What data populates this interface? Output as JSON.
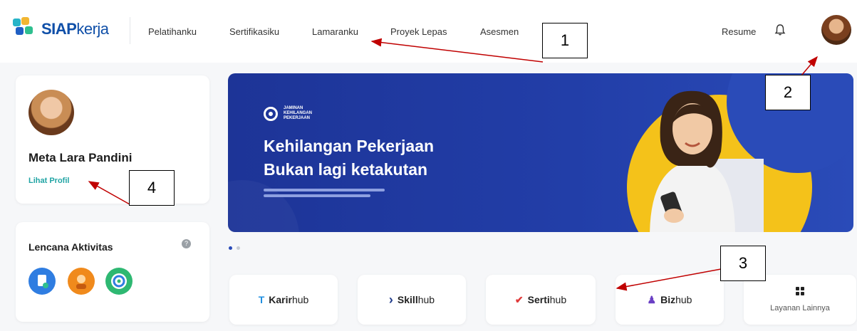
{
  "header": {
    "logo_bold": "SIAP",
    "logo_light": "kerja",
    "nav": [
      "Pelatihanku",
      "Sertifikasiku",
      "Lamaranku",
      "Proyek Lepas",
      "Asesmen"
    ],
    "resume": "Resume",
    "icons": {
      "notification": "bell-icon",
      "avatar": "user-avatar"
    }
  },
  "profile": {
    "name": "Meta Lara Pandini",
    "link": "Lihat Profil"
  },
  "badges": {
    "title": "Lencana Aktivitas",
    "help": "?",
    "colors": [
      "#2f7de1",
      "#f08a1c",
      "#2eb872"
    ]
  },
  "banner": {
    "logo_text": "JAMINAN KEHILANGAN PEKERJAAN",
    "title_line1": "Kehilangan Pekerjaan",
    "title_line2": "Bukan lagi ketakutan"
  },
  "services": [
    {
      "bold": "Karir",
      "light": "hub",
      "icon": "T",
      "color": "#1f8fe0"
    },
    {
      "bold": "Skill",
      "light": "hub",
      "icon": "›",
      "color": "#1f3a8a"
    },
    {
      "bold": "Serti",
      "light": "hub",
      "icon": "✔",
      "color": "#e03a3a"
    },
    {
      "bold": "Biz",
      "light": "hub",
      "icon": "♟",
      "color": "#6a3fc4"
    }
  ],
  "more_services": "Layanan Lainnya",
  "annotations": [
    "1",
    "2",
    "3",
    "4"
  ]
}
